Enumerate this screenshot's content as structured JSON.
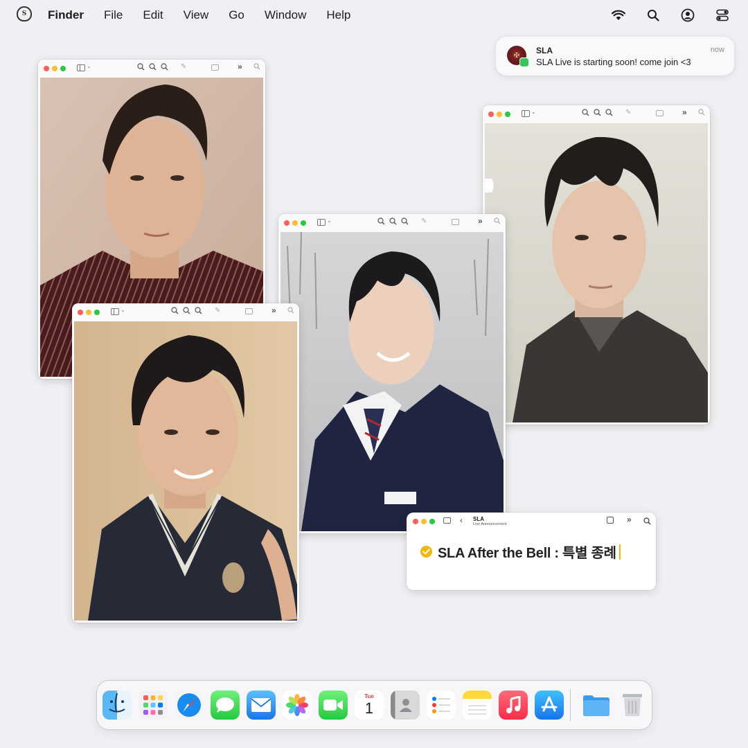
{
  "menubar": {
    "app_name": "Finder",
    "items": [
      "File",
      "Edit",
      "View",
      "Go",
      "Window",
      "Help"
    ],
    "logo_icon": "school-crest-icon",
    "status_icons": [
      "wifi-icon",
      "search-icon",
      "user-account-icon",
      "control-center-icon"
    ]
  },
  "notification": {
    "title": "SLA",
    "message": "SLA Live is starting soon! come join <3",
    "time": "now",
    "app_icon": "messages-icon"
  },
  "windows": [
    {
      "id": "preview-1",
      "content": "photo-student-striped-shirt"
    },
    {
      "id": "preview-2",
      "content": "photo-student-dark-coat"
    },
    {
      "id": "preview-3",
      "content": "photo-student-school-uniform"
    },
    {
      "id": "preview-4",
      "content": "photo-student-knit-vest"
    }
  ],
  "notes": {
    "account_name": "SLA",
    "account_subtitle": "Live Announcement",
    "body_text": "SLA After the Bell : 특별 종례",
    "accent": "#f2b705"
  },
  "dock": {
    "apps": [
      "finder-icon",
      "launchpad-icon",
      "safari-icon",
      "messages-icon",
      "mail-icon",
      "photos-icon",
      "facetime-icon",
      "calendar-icon",
      "contacts-icon",
      "reminders-icon",
      "notes-icon",
      "music-icon",
      "app-store-icon",
      "folder-icon",
      "trash-icon"
    ],
    "calendar": {
      "month": "Tue",
      "day": "1"
    }
  }
}
